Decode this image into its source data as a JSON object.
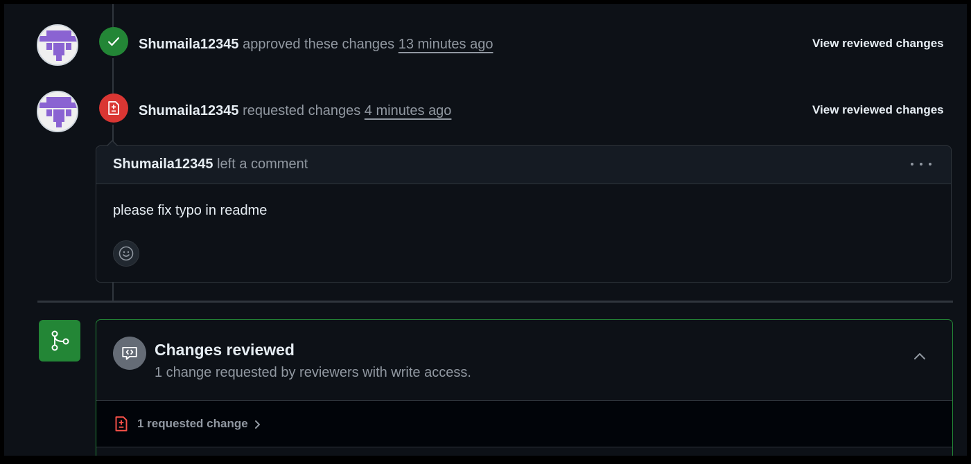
{
  "colors": {
    "background": "#0d1117",
    "approved_green": "#238636",
    "changes_red": "#da3633",
    "muted_text": "#9198a1",
    "border": "#30363d"
  },
  "events": [
    {
      "user": "Shumaila12345",
      "action": "approved these changes",
      "time": "13 minutes ago",
      "link": "View reviewed changes",
      "icon": "check-icon"
    },
    {
      "user": "Shumaila12345",
      "action": "requested changes",
      "time": "4 minutes ago",
      "link": "View reviewed changes",
      "icon": "file-diff-icon"
    }
  ],
  "comment": {
    "author": "Shumaila12345",
    "action": "left a comment",
    "body": "please fix typo in readme",
    "menu_icon": "kebab-horizontal-icon",
    "reaction_icon": "smiley-icon"
  },
  "review_summary": {
    "title": "Changes reviewed",
    "subtitle": "1 change requested by reviewers with write access.",
    "row_label": "1 requested change",
    "merge_icon": "git-branch-icon",
    "summary_icon": "code-review-icon",
    "collapse_icon": "chevron-up-icon"
  }
}
